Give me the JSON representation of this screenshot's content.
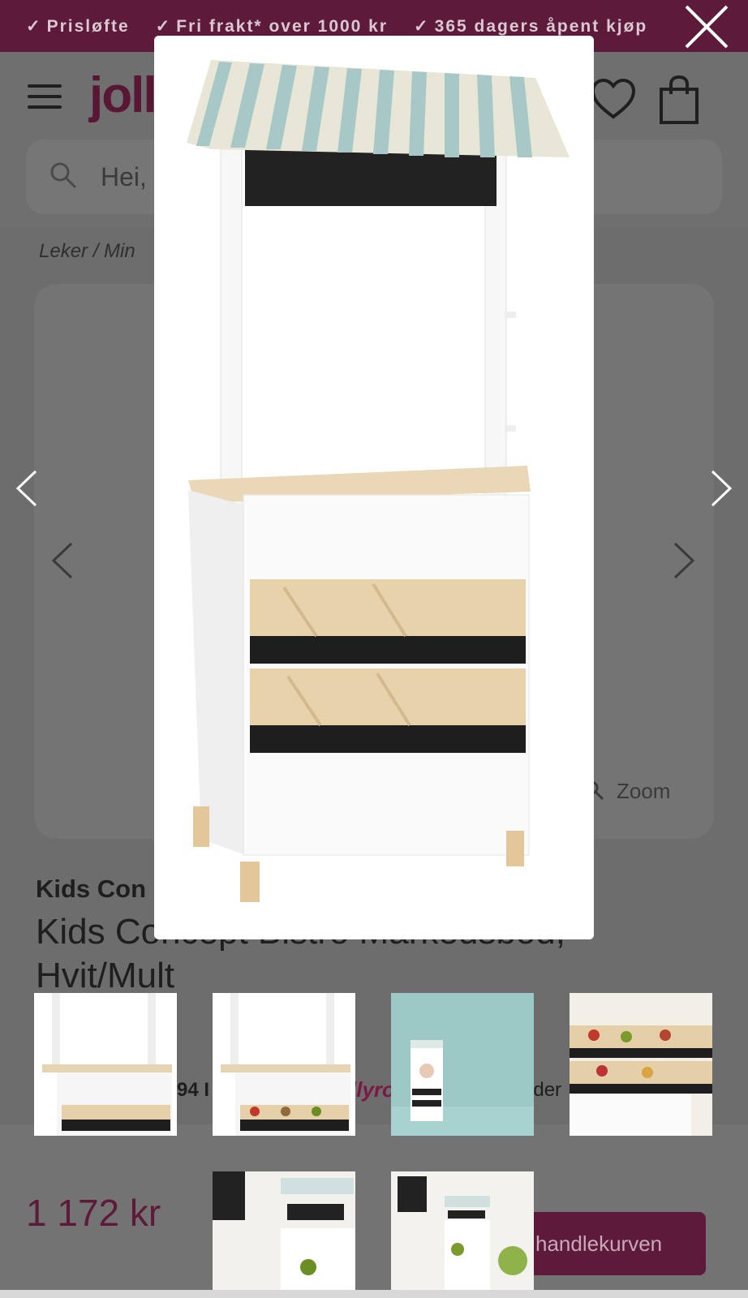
{
  "promo": {
    "items": [
      "Prisløfte",
      "Fri frakt* over 1000 kr",
      "365 dagers åpent kjøp"
    ]
  },
  "header": {
    "logo": "jolly",
    "search_placeholder": "Hei,"
  },
  "breadcrumb": "Leker /  Min",
  "gallery": {
    "zoom_label": "Zoom"
  },
  "product": {
    "brand": "Kids Con",
    "title_line1": "Kids Concept Bistro Markedsbod,",
    "title_line2": "Hvit/Mult",
    "rating_fragment": "94 I",
    "jollyrom_fragment": "llyro",
    "fragment_right": "eder",
    "price": "1 172 kr",
    "cart_button": "handlekurven"
  },
  "colors": {
    "brand": "#5e1a3a",
    "accent_fill": "#5e1a3a"
  },
  "icons": {
    "menu": "hamburger-icon",
    "wishlist": "heart-icon",
    "cart": "shopping-bag-icon",
    "search": "search-icon",
    "close": "close-icon",
    "prev": "chevron-left-icon",
    "next": "chevron-right-icon",
    "zoom": "zoom-icon"
  }
}
